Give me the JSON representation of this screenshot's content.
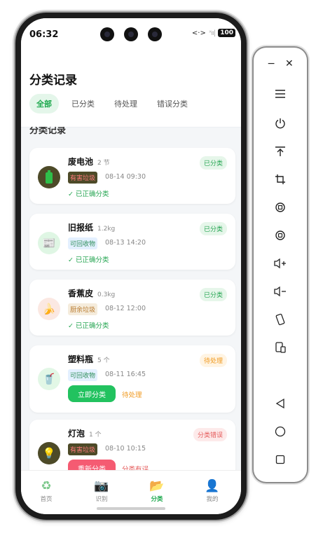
{
  "status": {
    "time": "06:32",
    "battery": "100"
  },
  "header": {
    "title": "分类记录",
    "tabs": [
      {
        "label": "全部",
        "active": true
      },
      {
        "label": "已分类",
        "active": false
      },
      {
        "label": "待处理",
        "active": false
      },
      {
        "label": "错误分类",
        "active": false
      }
    ]
  },
  "list": {
    "section_title": "分类记录",
    "items": [
      {
        "name": "废电池",
        "qty": "2 节",
        "category": "有害垃圾",
        "time": "08-14 09:30",
        "status": "已分类",
        "note": "✓ 已正确分类",
        "icon": "battery-icon"
      },
      {
        "name": "旧报纸",
        "qty": "1.2kg",
        "category": "可回收物",
        "time": "08-13 14:20",
        "status": "已分类",
        "note": "✓ 已正确分类",
        "icon": "newspaper-icon"
      },
      {
        "name": "香蕉皮",
        "qty": "0.3kg",
        "category": "厨余垃圾",
        "time": "08-12 12:00",
        "status": "已分类",
        "note": "✓ 已正确分类",
        "icon": "banana-icon"
      },
      {
        "name": "塑料瓶",
        "qty": "5 个",
        "category": "可回收物",
        "time": "08-11 16:45",
        "status": "待处理",
        "button": "立即分类",
        "hint": "待处理",
        "icon": "cup-icon"
      },
      {
        "name": "灯泡",
        "qty": "1 个",
        "category": "有害垃圾",
        "time": "08-10 10:15",
        "status": "分类错误",
        "button": "重新分类",
        "hint": "分类有误",
        "icon": "bulb-icon"
      }
    ]
  },
  "tabbar": {
    "items": [
      {
        "label": "首页",
        "icon": "recycle-icon",
        "active": false
      },
      {
        "label": "识别",
        "icon": "camera-icon",
        "active": false
      },
      {
        "label": "分类",
        "icon": "folder-icon",
        "active": true
      },
      {
        "label": "我的",
        "icon": "user-icon",
        "active": false
      }
    ]
  },
  "colors": {
    "accent": "#1ea94e",
    "danger": "#f55b72",
    "warning": "#f09a21"
  }
}
